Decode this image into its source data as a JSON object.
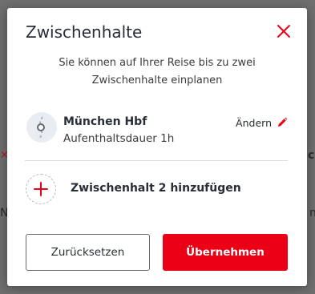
{
  "background": {
    "fragment_right": "ch",
    "fragment_left_accent": "×",
    "fragment_left_edge": "N",
    "fragment_right_edge": "n"
  },
  "dialog": {
    "title": "Zwischenhalte",
    "close_icon": "close-icon",
    "subtitle": "Sie können auf Ihrer Reise bis zu zwei Zwischenhalte einplanen",
    "stop": {
      "name": "München Hbf",
      "duration": "Aufenthaltsdauer 1h",
      "edit_label": "Ändern"
    },
    "add_stop_label": "Zwischenhalt 2 hinzufügen",
    "reset_label": "Zurücksetzen",
    "apply_label": "Übernehmen"
  },
  "colors": {
    "accent": "#ec0016",
    "text": "#282d37",
    "overlay": "#6e6e6e"
  }
}
